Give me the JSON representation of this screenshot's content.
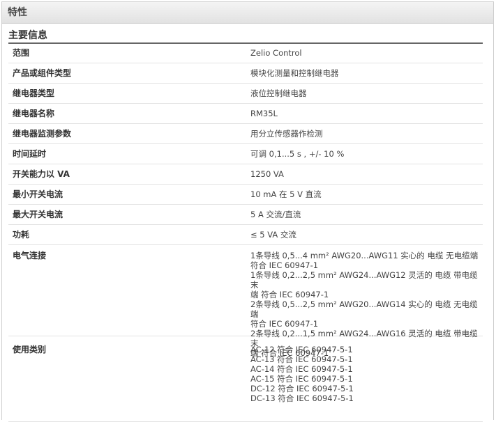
{
  "header": {
    "title": "特性"
  },
  "section": {
    "title": "主要信息"
  },
  "rows": [
    {
      "key": "范围",
      "value": "Zelio Control"
    },
    {
      "key": "产品或组件类型",
      "value": "模块化测量和控制继电器"
    },
    {
      "key": "继电器类型",
      "value": "液位控制继电器"
    },
    {
      "key": "继电器名称",
      "value": "RM35L"
    },
    {
      "key": "继电器监测参数",
      "value": "用分立传感器作检测"
    },
    {
      "key": "时间延时",
      "value": "可调 0,1...5 s , +/- 10 %"
    },
    {
      "key": "开关能力以 VA",
      "value": "1250 VA"
    },
    {
      "key": "最小开关电流",
      "value": "10 mA 在 5 V 直流"
    },
    {
      "key": "最大开关电流",
      "value": "5 A 交流/直流"
    },
    {
      "key": "功耗",
      "value": "≤ 5 VA 交流"
    },
    {
      "key": "电气连接",
      "value": "1条导线 0,5...4 mm² AWG20...AWG11 实心的 电缆 无电缆端\n符合 IEC 60947-1\n1条导线 0,2...2,5 mm² AWG24...AWG12 灵活的 电缆 带电缆末\n端 符合 IEC 60947-1\n2条导线 0,5...2,5 mm² AWG20...AWG14 实心的 电缆 无电缆端\n符合 IEC 60947-1\n2条导线 0,2...1,5 mm² AWG24...AWG16 灵活的 电缆 带电缆末\n端 符合 IEC 60947-1"
    },
    {
      "key": "使用类别",
      "value": "AC-12 符合 IEC 60947-5-1\nAC-13 符合 IEC 60947-5-1\nAC-14 符合 IEC 60947-5-1\nAC-15 符合 IEC 60947-5-1\nDC-12 符合 IEC 60947-5-1\nDC-13 符合 IEC 60947-5-1"
    }
  ]
}
